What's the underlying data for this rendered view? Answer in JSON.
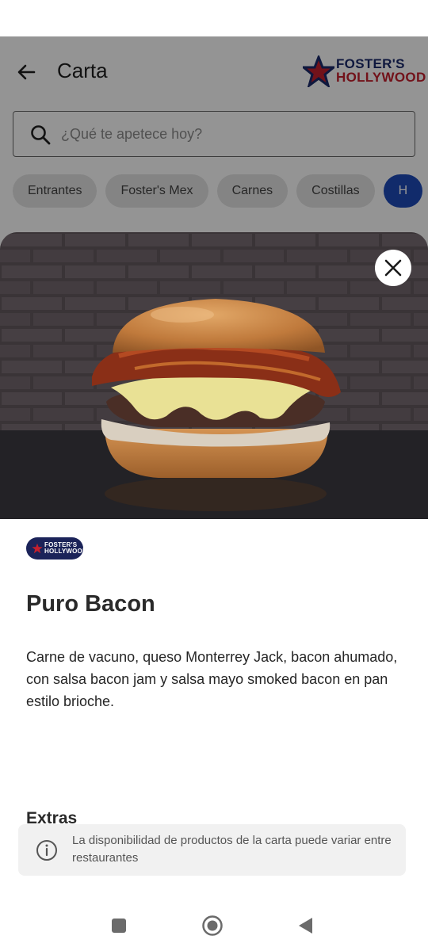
{
  "app_bar": {
    "title": "Carta",
    "back_icon": "arrow-left-icon"
  },
  "brand": {
    "line1": "FOSTER'S",
    "line2": "HOLLYWOOD",
    "badge_line1": "FOSTER'S",
    "badge_line2": "HOLLYWOOD",
    "colors": {
      "navy": "#1b2a6b",
      "red": "#c41f2d"
    }
  },
  "search": {
    "placeholder": "¿Qué te apetece hoy?",
    "value": "",
    "icon": "search-icon"
  },
  "categories": [
    {
      "label": "Entrantes",
      "active": false
    },
    {
      "label": "Foster's Mex",
      "active": false
    },
    {
      "label": "Carnes",
      "active": false
    },
    {
      "label": "Costillas",
      "active": false
    },
    {
      "label": "H",
      "active": true
    }
  ],
  "product": {
    "name": "Puro Bacon",
    "description": "Carne de vacuno, queso Monterrey Jack, bacon ahumado, con salsa bacon jam y salsa mayo smoked bacon en pan estilo brioche.",
    "extras_heading": "Extras",
    "image": "burger-photo"
  },
  "notice": {
    "text": "La disponibilidad de productos de la carta puede variar entre restaurantes",
    "icon": "info-icon"
  },
  "system_nav": {
    "items": [
      "recents-icon",
      "home-icon",
      "back-icon"
    ]
  },
  "colors": {
    "accent": "#1e4bb8",
    "chip_bg": "#e3e3e3"
  }
}
